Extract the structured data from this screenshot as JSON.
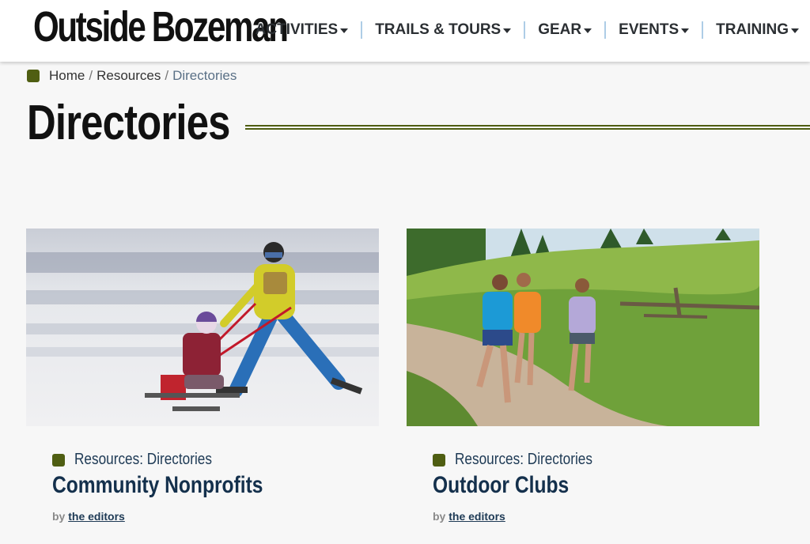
{
  "site": {
    "logo_text": "Outside Bozeman"
  },
  "nav": {
    "items": [
      {
        "label": "ACTIVITIES"
      },
      {
        "label": "TRAILS & TOURS"
      },
      {
        "label": "GEAR"
      },
      {
        "label": "EVENTS"
      },
      {
        "label": "TRAINING"
      }
    ]
  },
  "breadcrumb": {
    "home": "Home",
    "sep": "/",
    "resources": "Resources",
    "current": "Directories"
  },
  "page": {
    "title": "Directories"
  },
  "cards": [
    {
      "category": "Resources: Directories",
      "title": "Community Nonprofits",
      "by": "by",
      "author": "the editors"
    },
    {
      "category": "Resources: Directories",
      "title": "Outdoor Clubs",
      "by": "by",
      "author": "the editors"
    }
  ],
  "colors": {
    "accent_olive": "#4f5e12",
    "title_navy": "#14304c",
    "nav_separator": "#aecde6"
  }
}
